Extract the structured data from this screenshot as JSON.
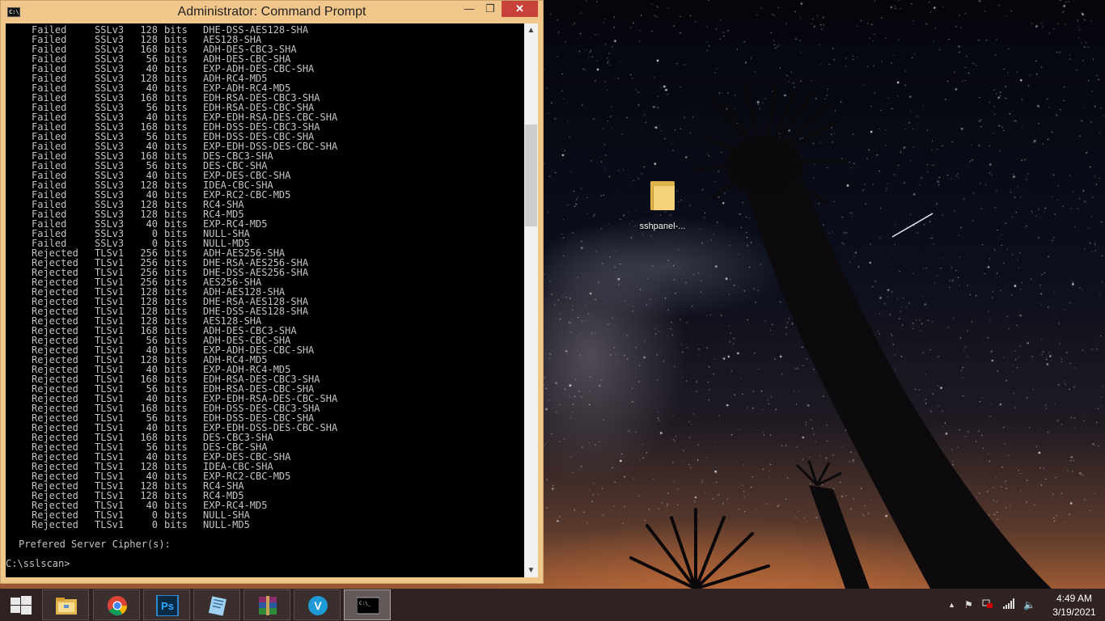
{
  "window": {
    "title": "Administrator: Command Prompt",
    "controls": {
      "minimize": "—",
      "maximize": "❐",
      "close": "✕"
    }
  },
  "console": {
    "rows": [
      [
        "Failed",
        "SSLv3",
        "128",
        "bits",
        "DHE-DSS-AES128-SHA"
      ],
      [
        "Failed",
        "SSLv3",
        "128",
        "bits",
        "AES128-SHA"
      ],
      [
        "Failed",
        "SSLv3",
        "168",
        "bits",
        "ADH-DES-CBC3-SHA"
      ],
      [
        "Failed",
        "SSLv3",
        "56",
        "bits",
        "ADH-DES-CBC-SHA"
      ],
      [
        "Failed",
        "SSLv3",
        "40",
        "bits",
        "EXP-ADH-DES-CBC-SHA"
      ],
      [
        "Failed",
        "SSLv3",
        "128",
        "bits",
        "ADH-RC4-MD5"
      ],
      [
        "Failed",
        "SSLv3",
        "40",
        "bits",
        "EXP-ADH-RC4-MD5"
      ],
      [
        "Failed",
        "SSLv3",
        "168",
        "bits",
        "EDH-RSA-DES-CBC3-SHA"
      ],
      [
        "Failed",
        "SSLv3",
        "56",
        "bits",
        "EDH-RSA-DES-CBC-SHA"
      ],
      [
        "Failed",
        "SSLv3",
        "40",
        "bits",
        "EXP-EDH-RSA-DES-CBC-SHA"
      ],
      [
        "Failed",
        "SSLv3",
        "168",
        "bits",
        "EDH-DSS-DES-CBC3-SHA"
      ],
      [
        "Failed",
        "SSLv3",
        "56",
        "bits",
        "EDH-DSS-DES-CBC-SHA"
      ],
      [
        "Failed",
        "SSLv3",
        "40",
        "bits",
        "EXP-EDH-DSS-DES-CBC-SHA"
      ],
      [
        "Failed",
        "SSLv3",
        "168",
        "bits",
        "DES-CBC3-SHA"
      ],
      [
        "Failed",
        "SSLv3",
        "56",
        "bits",
        "DES-CBC-SHA"
      ],
      [
        "Failed",
        "SSLv3",
        "40",
        "bits",
        "EXP-DES-CBC-SHA"
      ],
      [
        "Failed",
        "SSLv3",
        "128",
        "bits",
        "IDEA-CBC-SHA"
      ],
      [
        "Failed",
        "SSLv3",
        "40",
        "bits",
        "EXP-RC2-CBC-MD5"
      ],
      [
        "Failed",
        "SSLv3",
        "128",
        "bits",
        "RC4-SHA"
      ],
      [
        "Failed",
        "SSLv3",
        "128",
        "bits",
        "RC4-MD5"
      ],
      [
        "Failed",
        "SSLv3",
        "40",
        "bits",
        "EXP-RC4-MD5"
      ],
      [
        "Failed",
        "SSLv3",
        "0",
        "bits",
        "NULL-SHA"
      ],
      [
        "Failed",
        "SSLv3",
        "0",
        "bits",
        "NULL-MD5"
      ],
      [
        "Rejected",
        "TLSv1",
        "256",
        "bits",
        "ADH-AES256-SHA"
      ],
      [
        "Rejected",
        "TLSv1",
        "256",
        "bits",
        "DHE-RSA-AES256-SHA"
      ],
      [
        "Rejected",
        "TLSv1",
        "256",
        "bits",
        "DHE-DSS-AES256-SHA"
      ],
      [
        "Rejected",
        "TLSv1",
        "256",
        "bits",
        "AES256-SHA"
      ],
      [
        "Rejected",
        "TLSv1",
        "128",
        "bits",
        "ADH-AES128-SHA"
      ],
      [
        "Rejected",
        "TLSv1",
        "128",
        "bits",
        "DHE-RSA-AES128-SHA"
      ],
      [
        "Rejected",
        "TLSv1",
        "128",
        "bits",
        "DHE-DSS-AES128-SHA"
      ],
      [
        "Rejected",
        "TLSv1",
        "128",
        "bits",
        "AES128-SHA"
      ],
      [
        "Rejected",
        "TLSv1",
        "168",
        "bits",
        "ADH-DES-CBC3-SHA"
      ],
      [
        "Rejected",
        "TLSv1",
        "56",
        "bits",
        "ADH-DES-CBC-SHA"
      ],
      [
        "Rejected",
        "TLSv1",
        "40",
        "bits",
        "EXP-ADH-DES-CBC-SHA"
      ],
      [
        "Rejected",
        "TLSv1",
        "128",
        "bits",
        "ADH-RC4-MD5"
      ],
      [
        "Rejected",
        "TLSv1",
        "40",
        "bits",
        "EXP-ADH-RC4-MD5"
      ],
      [
        "Rejected",
        "TLSv1",
        "168",
        "bits",
        "EDH-RSA-DES-CBC3-SHA"
      ],
      [
        "Rejected",
        "TLSv1",
        "56",
        "bits",
        "EDH-RSA-DES-CBC-SHA"
      ],
      [
        "Rejected",
        "TLSv1",
        "40",
        "bits",
        "EXP-EDH-RSA-DES-CBC-SHA"
      ],
      [
        "Rejected",
        "TLSv1",
        "168",
        "bits",
        "EDH-DSS-DES-CBC3-SHA"
      ],
      [
        "Rejected",
        "TLSv1",
        "56",
        "bits",
        "EDH-DSS-DES-CBC-SHA"
      ],
      [
        "Rejected",
        "TLSv1",
        "40",
        "bits",
        "EXP-EDH-DSS-DES-CBC-SHA"
      ],
      [
        "Rejected",
        "TLSv1",
        "168",
        "bits",
        "DES-CBC3-SHA"
      ],
      [
        "Rejected",
        "TLSv1",
        "56",
        "bits",
        "DES-CBC-SHA"
      ],
      [
        "Rejected",
        "TLSv1",
        "40",
        "bits",
        "EXP-DES-CBC-SHA"
      ],
      [
        "Rejected",
        "TLSv1",
        "128",
        "bits",
        "IDEA-CBC-SHA"
      ],
      [
        "Rejected",
        "TLSv1",
        "40",
        "bits",
        "EXP-RC2-CBC-MD5"
      ],
      [
        "Rejected",
        "TLSv1",
        "128",
        "bits",
        "RC4-SHA"
      ],
      [
        "Rejected",
        "TLSv1",
        "128",
        "bits",
        "RC4-MD5"
      ],
      [
        "Rejected",
        "TLSv1",
        "40",
        "bits",
        "EXP-RC4-MD5"
      ],
      [
        "Rejected",
        "TLSv1",
        "0",
        "bits",
        "NULL-SHA"
      ],
      [
        "Rejected",
        "TLSv1",
        "0",
        "bits",
        "NULL-MD5"
      ]
    ],
    "preferred_heading": "Prefered Server Cipher(s):",
    "prompt": "C:\\sslscan>"
  },
  "desktop": {
    "icons": [
      {
        "label": "sshpanel-...",
        "icon": "folder-icon"
      }
    ]
  },
  "taskbar": {
    "apps": [
      {
        "name": "File Explorer",
        "icon": "file-explorer-icon",
        "active": false
      },
      {
        "name": "Google Chrome",
        "icon": "chrome-icon",
        "active": false
      },
      {
        "name": "Adobe Photoshop",
        "icon": "photoshop-icon",
        "active": false,
        "glyph": "Ps"
      },
      {
        "name": "Notepad",
        "icon": "notepad-icon",
        "active": false
      },
      {
        "name": "WinRAR",
        "icon": "winrar-icon",
        "active": false
      },
      {
        "name": "Vysor",
        "icon": "vysor-icon",
        "active": false,
        "glyph": "V"
      },
      {
        "name": "Command Prompt",
        "icon": "command-prompt-icon",
        "active": true,
        "glyph": "C:\\_"
      }
    ],
    "tray": {
      "icons": [
        "show-hidden-icons-arrow",
        "action-center-flag-icon",
        "network-icon",
        "signal-bars-icon",
        "volume-icon"
      ]
    },
    "clock": {
      "time": "4:49 AM",
      "date": "3/19/2021"
    }
  },
  "colors": {
    "title_bar": "#f1c68b",
    "close_button": "#c7433a",
    "console_bg": "#000000",
    "console_text": "#c4c4c4",
    "taskbar": "#322422"
  }
}
